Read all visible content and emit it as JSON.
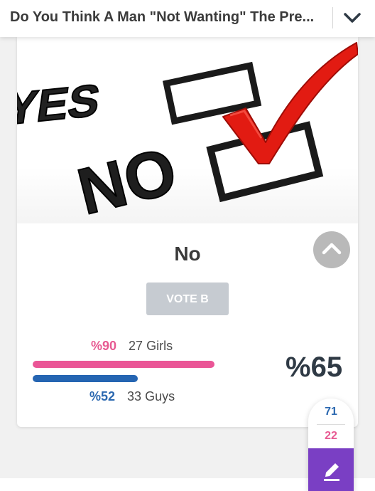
{
  "header": {
    "title": "Do You Think A Man \"Not Wanting\" The Pre...",
    "expand_icon": "chevron-down-icon"
  },
  "poll": {
    "option_label": "No",
    "vote_button_label": "VOTE B",
    "girls": {
      "percent_text": "%90",
      "count_text": "27 Girls",
      "fraction": 0.9
    },
    "guys": {
      "percent_text": "%52",
      "count_text": "33 Guys",
      "fraction": 0.52
    },
    "overall_percent_text": "%65"
  },
  "counter": {
    "top_value": "71",
    "bottom_value": "22",
    "edit_icon": "pencil-icon"
  },
  "colors": {
    "pink": "#ea5596",
    "blue": "#2565b2",
    "purple": "#7a3fc4",
    "check_red": "#e21b12"
  }
}
